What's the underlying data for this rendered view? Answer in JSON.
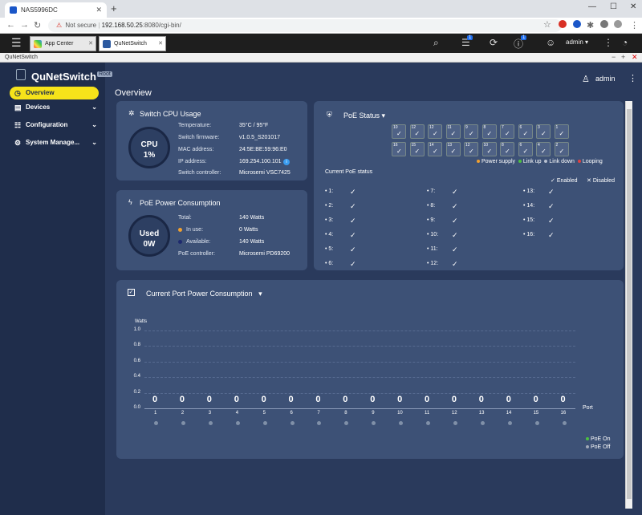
{
  "browser": {
    "tab_title": "NAS5996DC",
    "url_security": "Not secure",
    "url_host": "192.168.50.25",
    "url_path": ":8080/cgi-bin/"
  },
  "qts": {
    "tabs": [
      "App Center",
      "QuNetSwitch"
    ],
    "badge1": "1",
    "badge2": "1",
    "user": "admin",
    "window_title": "QuNetSwitch"
  },
  "app": {
    "name": "QuNetSwitch",
    "debug_tag": "Root",
    "user": "admin",
    "page_title": "Overview"
  },
  "sidebar": {
    "items": [
      {
        "label": "Overview"
      },
      {
        "label": "Devices"
      },
      {
        "label": "Configuration"
      },
      {
        "label": "System Manage..."
      }
    ]
  },
  "cpu": {
    "title": "Switch CPU Usage",
    "ring_label": "CPU",
    "ring_value": "1%",
    "rows": [
      {
        "k": "Temperature:",
        "v": "35°C / 95°F"
      },
      {
        "k": "Switch firmware:",
        "v": "v1.0.5_S201017"
      },
      {
        "k": "MAC address:",
        "v": "24:5E:BE:59:96:E0"
      },
      {
        "k": "IP address:",
        "v": "169.254.100.101"
      },
      {
        "k": "Switch controller:",
        "v": "Microsemi VSC7425"
      }
    ]
  },
  "poe_power": {
    "title": "PoE Power Consumption",
    "ring_label": "Used",
    "ring_value": "0W",
    "rows": [
      {
        "k": "Total:",
        "v": "140 Watts"
      },
      {
        "k": "In use:",
        "v": "0 Watts"
      },
      {
        "k": "Available:",
        "v": "140 Watts"
      },
      {
        "k": "PoE controller:",
        "v": "Microsemi PD69200"
      }
    ],
    "colors": {
      "in_use": "#f0a030",
      "available": "#1e2a6e"
    }
  },
  "poe_status": {
    "title": "PoE Status",
    "top_ports": [
      "10",
      "12",
      "12",
      "11",
      "9",
      "8",
      "7",
      "6",
      "3",
      "1"
    ],
    "bottom_ports": [
      "16",
      "15",
      "14",
      "13",
      "12",
      "10",
      "8",
      "6",
      "4",
      "2"
    ],
    "legend": [
      "Power supply",
      "Link up",
      "Link down",
      "Looping"
    ],
    "legend_colors": [
      "#f0a030",
      "#4cc040",
      "#b8c0d0",
      "#e04040"
    ],
    "section": "Current PoE status",
    "enabled": "Enabled",
    "disabled": "Disabled",
    "ports": [
      "1:",
      "2:",
      "3:",
      "4:",
      "5:",
      "6:",
      "7:",
      "8:",
      "9:",
      "10:",
      "11:",
      "12:",
      "13:",
      "14:",
      "15:",
      "16:"
    ]
  },
  "port_power": {
    "title": "Current Port Power Consumption",
    "legend_on": "PoE On",
    "legend_off": "PoE Off",
    "legend_colors": {
      "on": "#4cc040",
      "off": "#a0a8b8"
    }
  },
  "chart_data": {
    "type": "bar",
    "ylabel": "Watts",
    "xlabel": "Port",
    "ylim": [
      0,
      1.0
    ],
    "yticks": [
      "1.0",
      "0.8",
      "0.6",
      "0.4",
      "0.2",
      "0.0"
    ],
    "categories": [
      "1",
      "2",
      "3",
      "4",
      "5",
      "6",
      "7",
      "8",
      "9",
      "10",
      "11",
      "12",
      "13",
      "14",
      "15",
      "16"
    ],
    "values": [
      0,
      0,
      0,
      0,
      0,
      0,
      0,
      0,
      0,
      0,
      0,
      0,
      0,
      0,
      0,
      0
    ],
    "grid": true
  }
}
